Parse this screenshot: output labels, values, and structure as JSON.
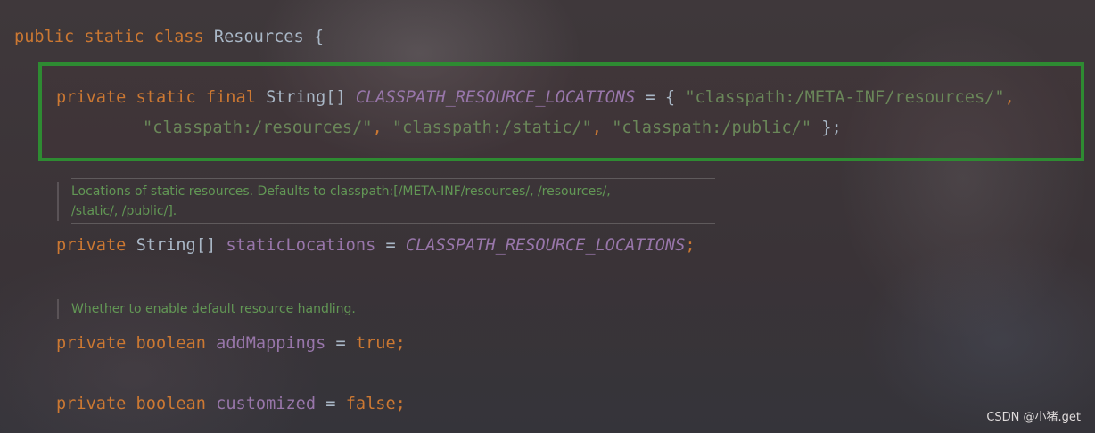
{
  "code": {
    "class_decl": {
      "modifiers": "public static class",
      "name": "Resources",
      "brace": "{"
    },
    "field1": {
      "modifiers": "private static final",
      "type": "String[]",
      "name": "CLASSPATH_RESOURCE_LOCATIONS",
      "op": "= {",
      "values": [
        "\"classpath:/META-INF/resources/\"",
        "\"classpath:/resources/\"",
        "\"classpath:/static/\"",
        "\"classpath:/public/\""
      ],
      "end": "};"
    },
    "doc1": {
      "line1": "Locations of static resources. Defaults to classpath:[/META-INF/resources/, /resources/,",
      "line2": "/static/, /public/]."
    },
    "field2": {
      "modifiers": "private",
      "type": "String[]",
      "name": "staticLocations",
      "op": "=",
      "value": "CLASSPATH_RESOURCE_LOCATIONS",
      "end": ";"
    },
    "doc2": {
      "line1": "Whether to enable default resource handling."
    },
    "field3": {
      "modifiers": "private boolean",
      "name": "addMappings",
      "op": "=",
      "value": "true",
      "end": ";"
    },
    "field4": {
      "modifiers": "private boolean",
      "name": "customized",
      "op": "=",
      "value": "false",
      "end": ";"
    }
  },
  "watermark": "CSDN @小猪.get",
  "colors": {
    "keyword": "#cc7832",
    "constant": "#9876aa",
    "string": "#6a8759",
    "doc_comment": "#629755",
    "highlight_border": "#2e8b32"
  }
}
